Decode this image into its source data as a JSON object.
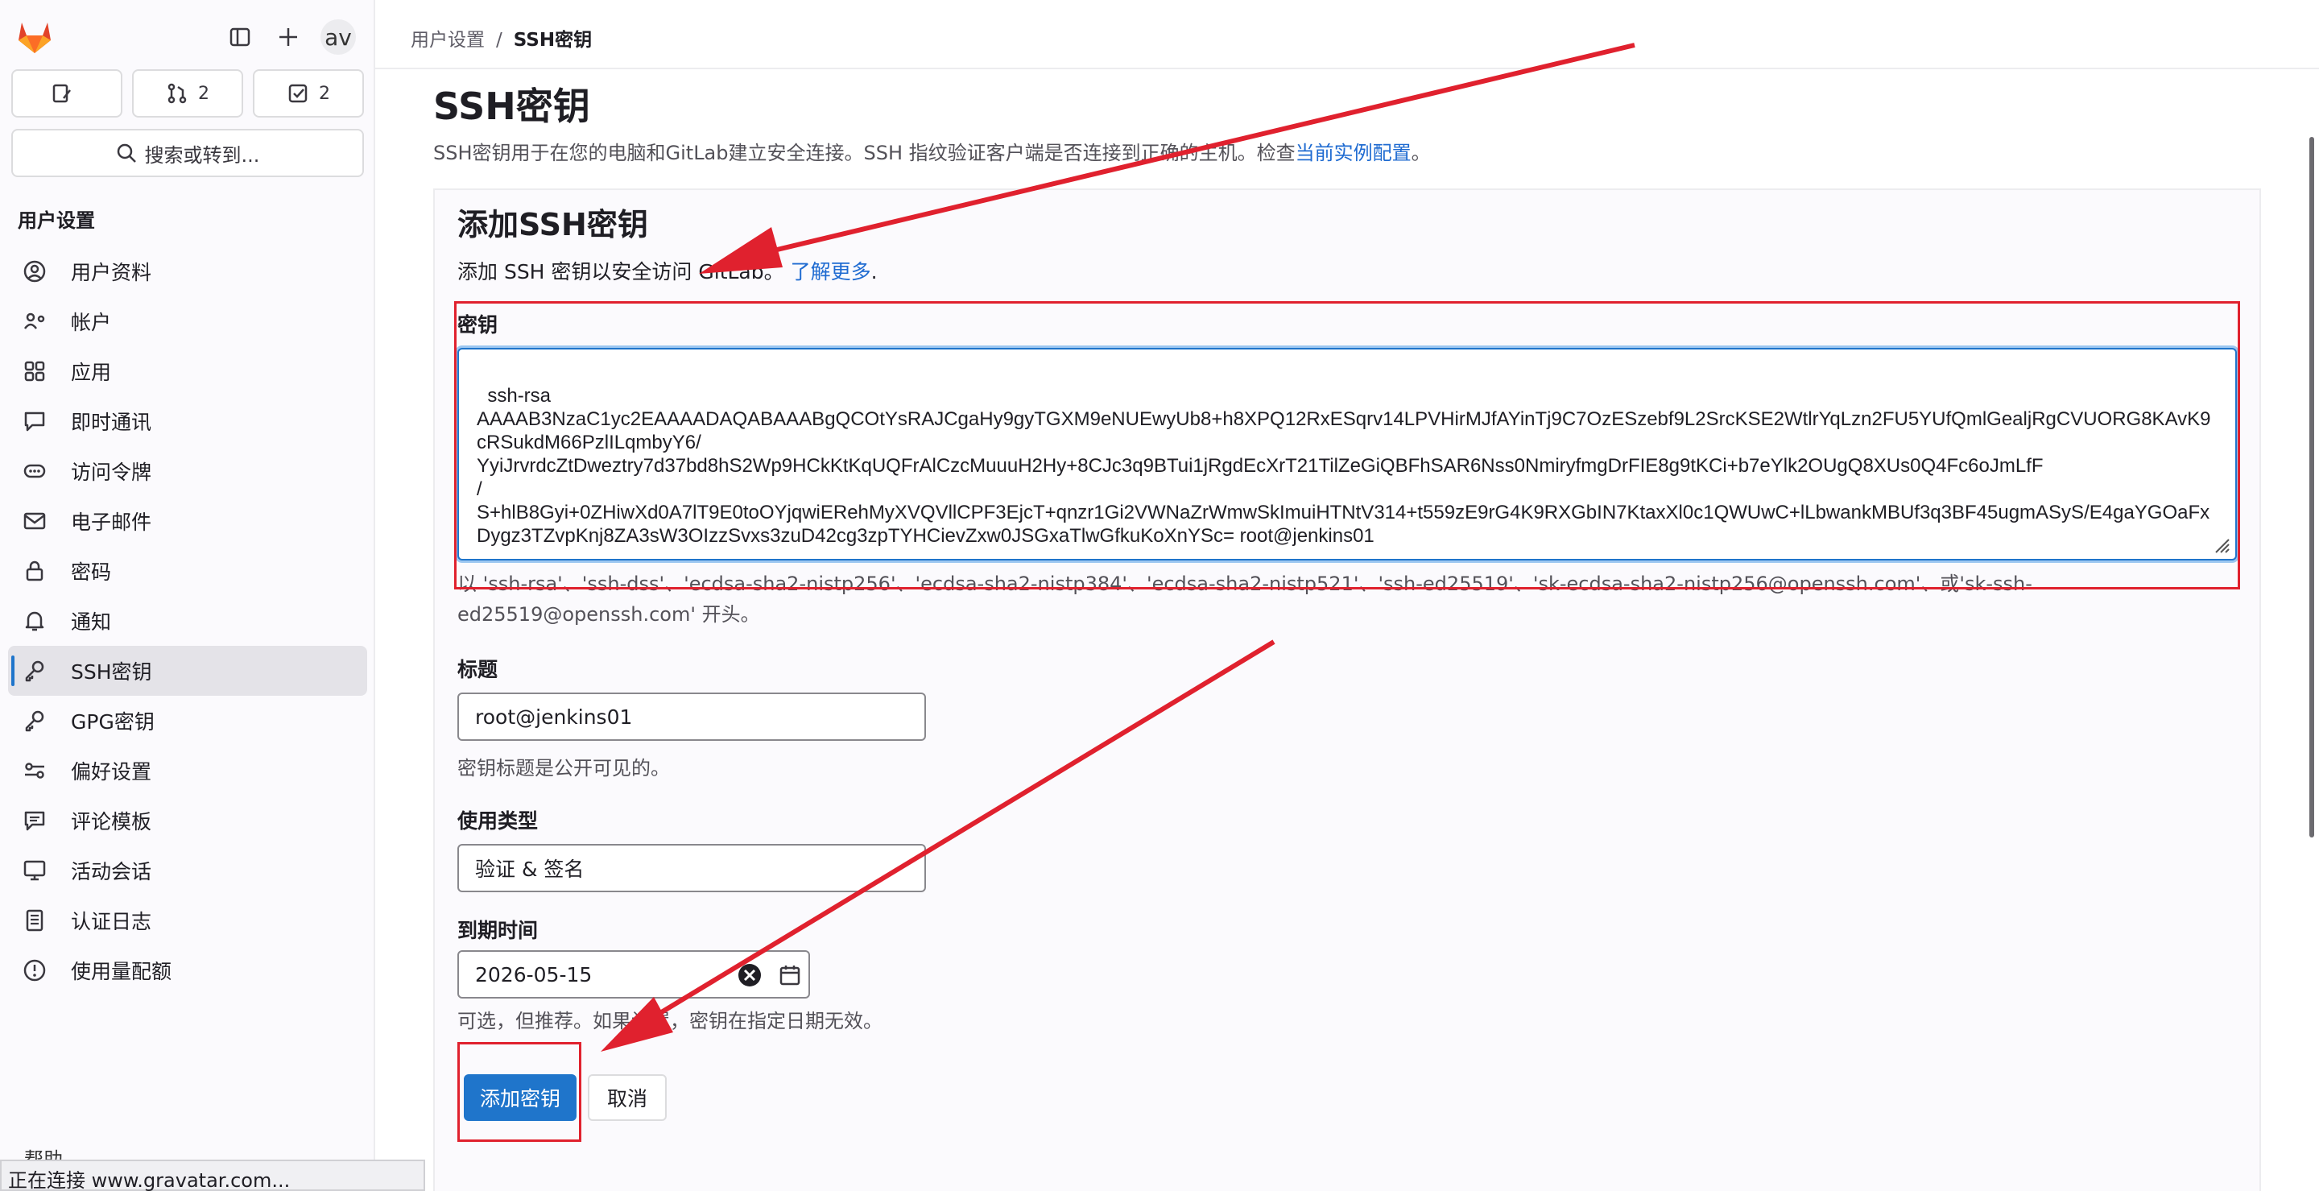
{
  "header": {
    "avatar_text": "av",
    "counts": [
      {
        "icon": "issue-icon",
        "value": ""
      },
      {
        "icon": "merge-request-icon",
        "value": "2"
      },
      {
        "icon": "todo-icon",
        "value": "2"
      }
    ],
    "search_label": "搜索或转到..."
  },
  "sidebar": {
    "section_title": "用户设置",
    "items": [
      {
        "label": "用户资料",
        "icon": "profile-icon"
      },
      {
        "label": "帐户",
        "icon": "account-icon"
      },
      {
        "label": "应用",
        "icon": "applications-icon"
      },
      {
        "label": "即时通讯",
        "icon": "chat-icon"
      },
      {
        "label": "访问令牌",
        "icon": "token-icon"
      },
      {
        "label": "电子邮件",
        "icon": "mail-icon"
      },
      {
        "label": "密码",
        "icon": "lock-icon"
      },
      {
        "label": "通知",
        "icon": "bell-icon"
      },
      {
        "label": "SSH密钥",
        "icon": "key-icon",
        "active": true
      },
      {
        "label": "GPG密钥",
        "icon": "key-icon"
      },
      {
        "label": "偏好设置",
        "icon": "preferences-icon"
      },
      {
        "label": "评论模板",
        "icon": "comment-icon"
      },
      {
        "label": "活动会话",
        "icon": "monitor-icon"
      },
      {
        "label": "认证日志",
        "icon": "log-icon"
      },
      {
        "label": "使用量配额",
        "icon": "quota-icon"
      }
    ],
    "help_label": "帮助"
  },
  "status_bar": "正在连接 www.gravatar.com...",
  "breadcrumb": {
    "parent": "用户设置",
    "separator": "/",
    "current": "SSH密钥"
  },
  "page": {
    "title": "SSH密钥",
    "description": "SSH密钥用于在您的电脑和GitLab建立安全连接。SSH 指纹验证客户端是否连接到正确的主机。检查",
    "description_link": "当前实例配置",
    "description_end": "。"
  },
  "form": {
    "title": "添加SSH密钥",
    "description": "添加 SSH 密钥以安全访问 GitLab。",
    "learn_more": "了解更多",
    "learn_more_end": ".",
    "key_label": "密钥",
    "key_value": "ssh-rsa\nAAAAB3NzaC1yc2EAAAADAQABAAABgQCOtYsRAJCgaHy9gyTGXM9eNUEwyUb8+h8XPQ12RxESqrv14LPVHirMJfAYinTj9C7OzESzebf9L2SrcKSE2WtlrYqLzn2FU5YUfQmlGealjRgCVUORG8KAvK9cRSukdM66PzlILqmbyY6/\nYyiJrvrdcZtDweztry7d37bd8hS2Wp9HCkKtKqUQFrAlCzcMuuuH2Hy+8CJc3q9BTui1jRgdEcXrT21TilZeGiQBFhSAR6Nss0NmiryfmgDrFIE8g9tKCi+b7eYlk2OUgQ8XUs0Q4Fc6oJmLfF\n/\nS+hlB8Gyi+0ZHiwXd0A7lT9E0toOYjqwiERehMyXVQVllCPF3EjcT+qnzr1Gi2VWNaZrWmwSkImuiHTNtV314+t559zE9rG4K9RXGbIN7KtaxXl0c1QWUwC+lLbwankMBUf3q3BF45ugmASyS/E4gaYGOaFxDygz3TZvpKnj8ZA3sW3OIzzSvxs3zuD42cg3zpTYHCievZxw0JSGxaTlwGfkuKoXnYSc= root@jenkins01",
    "key_hint": "以 'ssh-rsa'、'ssh-dss'、'ecdsa-sha2-nistp256'、'ecdsa-sha2-nistp384'、'ecdsa-sha2-nistp521'、'ssh-ed25519'、'sk-ecdsa-sha2-nistp256@openssh.com'、或'sk-ssh-ed25519@openssh.com' 开头。",
    "title_label": "标题",
    "title_value": "root@jenkins01",
    "title_hint": "密钥标题是公开可见的。",
    "usage_label": "使用类型",
    "usage_value": "验证 & 签名",
    "expiry_label": "到期时间",
    "expiry_value": "2026-05-15",
    "expiry_hint": "可选，但推荐。如果设置，密钥在指定日期无效。",
    "submit_label": "添加密钥",
    "cancel_label": "取消"
  },
  "colors": {
    "primary": "#1f75cb",
    "annotation": "#e0212e",
    "link": "#1f6bd1"
  }
}
